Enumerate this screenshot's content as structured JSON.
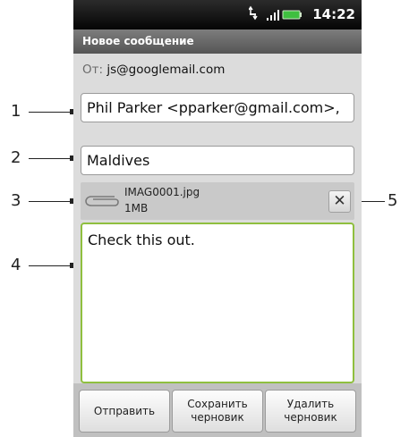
{
  "status_bar": {
    "time": "14:22",
    "icons": [
      "sync-icon",
      "signal-icon",
      "battery-icon"
    ]
  },
  "title_bar": {
    "title": "Новое сообщение"
  },
  "from": {
    "label": "От:",
    "value": "js@googlemail.com"
  },
  "to_field": {
    "value": "Phil Parker <pparker@gmail.com>,"
  },
  "subject_field": {
    "value": "Maldives"
  },
  "attachment": {
    "name": "IMAG0001.jpg",
    "size": "1MB",
    "icon": "paperclip-icon",
    "remove_icon": "close-icon",
    "remove_glyph": "✕"
  },
  "body_field": {
    "value": "Check this out."
  },
  "buttons": {
    "send": "Отправить",
    "save_draft": "Сохранить\nчерновик",
    "delete_draft": "Удалить\nчерновик"
  },
  "callouts": {
    "c1": "1",
    "c2": "2",
    "c3": "3",
    "c4": "4",
    "c5": "5"
  },
  "colors": {
    "body_focus_border": "#8fbf3f",
    "battery": "#3fbf3f"
  }
}
